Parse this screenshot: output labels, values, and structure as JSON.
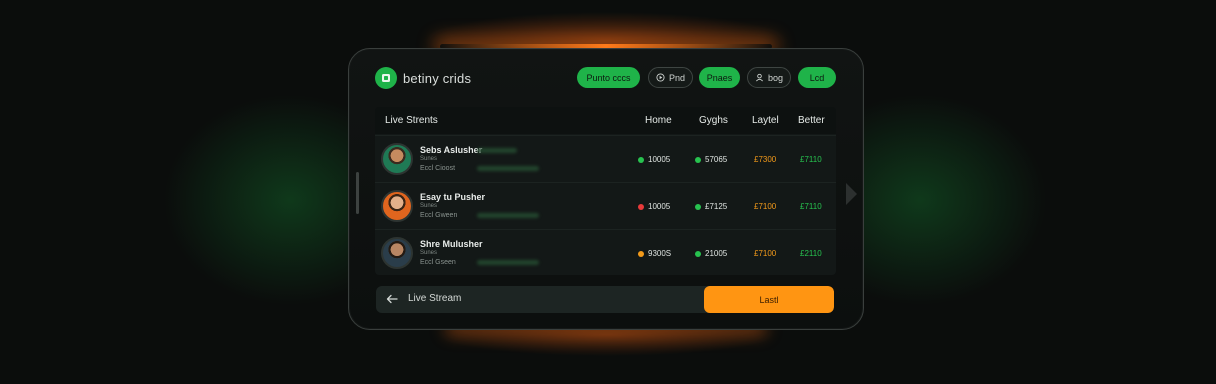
{
  "app": {
    "logo_text": "betiny crids"
  },
  "nav": [
    {
      "label": "Punto cccs",
      "style": "green"
    },
    {
      "label": "Pnd",
      "style": "dark"
    },
    {
      "label": "Pnaes",
      "style": "green"
    },
    {
      "label": "bog",
      "style": "dark"
    },
    {
      "label": "Lcd",
      "style": "green"
    }
  ],
  "table": {
    "title": "Live Strents",
    "columns": [
      "Home",
      "Gyghs",
      "Laytel",
      "Better"
    ],
    "rows": [
      {
        "name": "Sebs Aslusher",
        "sub": "Sunes",
        "sub2": "Eccl Cioost",
        "home": "10005",
        "home_dot": "#27c24f",
        "gyghs": "57065",
        "gyghs_dot": "#27c24f",
        "laytel": "£7300",
        "better": "£7110"
      },
      {
        "name": "Esay tu Pusher",
        "sub": "Sunes",
        "sub2": "Eccl Gween",
        "home": "10005",
        "home_dot": "#e83a3a",
        "gyghs": "£7125",
        "gyghs_dot": "#27c24f",
        "laytel": "£7100",
        "better": "£7110"
      },
      {
        "name": "Shre Mulusher",
        "sub": "Sunes",
        "sub2": "Eccl Gseen",
        "home": "9300S",
        "home_dot": "#f39a1a",
        "gyghs": "21005",
        "gyghs_dot": "#27c24f",
        "laytel": "£7100",
        "better": "£2110"
      }
    ]
  },
  "footer": {
    "back_label": "Live Stream",
    "action_label": "Lastl"
  },
  "colors": {
    "accent_green": "#1fb349",
    "accent_orange": "#ff9512",
    "background": "#0b0d0c"
  }
}
